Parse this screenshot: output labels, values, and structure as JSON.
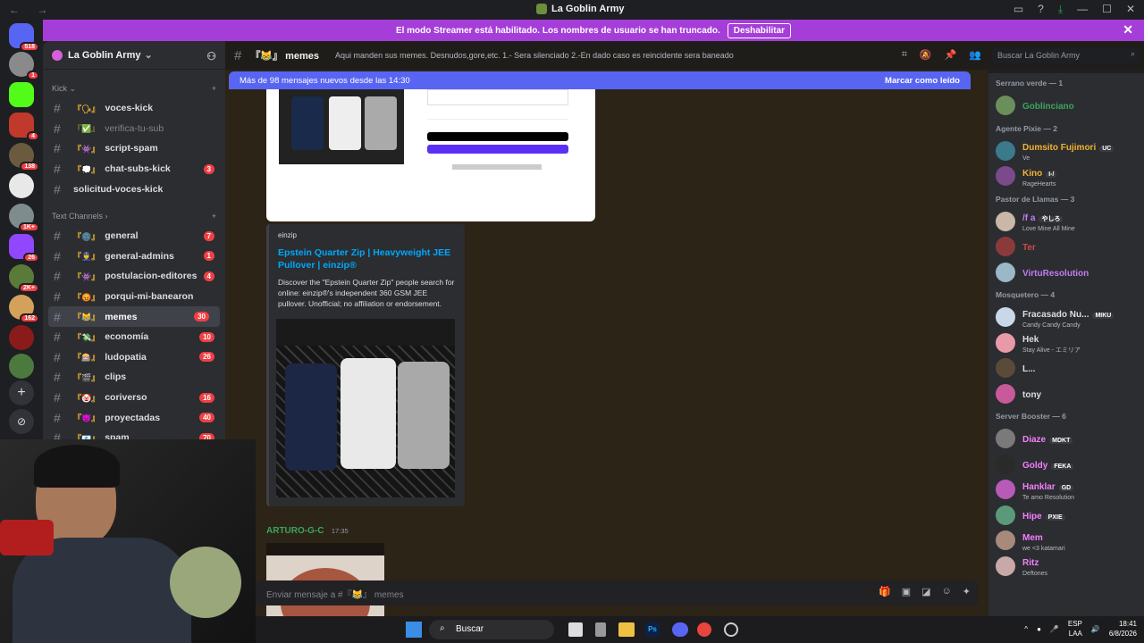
{
  "window": {
    "title": "La Goblin Army"
  },
  "streamer_banner": {
    "text": "El modo Streamer está habilitado. Los nombres de usuario se han truncado.",
    "button": "Deshabilitar"
  },
  "guild_badges": [
    "518",
    "1",
    "4",
    "138",
    "1K+",
    "26",
    "2K+",
    "162"
  ],
  "server": {
    "name": "La Goblin Army"
  },
  "categories": [
    {
      "name": "Kick",
      "channels": [
        {
          "name": "voces-kick",
          "emoji": "『🗣』",
          "muted": false,
          "badge": ""
        },
        {
          "name": "verifica-tu-sub",
          "emoji": "『✅』",
          "muted": true,
          "badge": ""
        },
        {
          "name": "script-spam",
          "emoji": "『👾』",
          "muted": false,
          "badge": ""
        },
        {
          "name": "chat-subs-kick",
          "emoji": "『💭』",
          "muted": false,
          "badge": "3"
        },
        {
          "name": "solicitud-voces-kick",
          "emoji": "",
          "muted": false,
          "badge": ""
        }
      ]
    },
    {
      "name": "Text Channels",
      "channels": [
        {
          "name": "general",
          "emoji": "『🌚』",
          "muted": false,
          "badge": "7"
        },
        {
          "name": "general-admins",
          "emoji": "『👮』",
          "muted": false,
          "badge": "1"
        },
        {
          "name": "postulacion-editores",
          "emoji": "『👾』",
          "muted": false,
          "badge": "4"
        },
        {
          "name": "porqui-mi-banearon",
          "emoji": "『😡』",
          "muted": false,
          "badge": ""
        },
        {
          "name": "memes",
          "emoji": "『😹』",
          "muted": false,
          "badge": "30",
          "active": true
        },
        {
          "name": "economía",
          "emoji": "『💸』",
          "muted": false,
          "badge": "10"
        },
        {
          "name": "ludopatia",
          "emoji": "『🎰』",
          "muted": false,
          "badge": "26"
        },
        {
          "name": "clips",
          "emoji": "『🎬』",
          "muted": false,
          "badge": ""
        },
        {
          "name": "coriverso",
          "emoji": "『🤡』",
          "muted": false,
          "badge": "16"
        },
        {
          "name": "proyectadas",
          "emoji": "『😈』",
          "muted": false,
          "badge": "40"
        },
        {
          "name": "spam",
          "emoji": "『📧』",
          "muted": false,
          "badge": "70"
        }
      ]
    }
  ],
  "channel_header": {
    "name": "memes",
    "emoji": "『😹』",
    "topic": "Aqui manden sus memes. Desnudos,gore,etc. 1.- Sera silenciado 2.-En dado caso es reincidente sera baneado"
  },
  "search": {
    "placeholder": "Buscar La Goblin Army"
  },
  "new_messages": {
    "text": "Más de 98 mensajes nuevos desde las 14:30",
    "mark": "Marcar como leído"
  },
  "embed": {
    "provider": "einzip",
    "title": "Epstein Quarter Zip | Heavyweight JEE Pullover | einzip®",
    "description": "Discover the \"Epstein Quarter Zip\" people search for online: einzip®'s independent 360 GSM JEE pullover. Unofficial; no affiliation or endorsement."
  },
  "message": {
    "author": "ARTURO-G-C",
    "time": "17:35"
  },
  "composer": {
    "placeholder": "Enviar mensaje a #『😹』 memes"
  },
  "member_groups": [
    {
      "name": "Serrano verde — 1",
      "members": [
        {
          "name": "Goblinciano",
          "status": "",
          "color": "#3ba55c",
          "tag": ""
        }
      ]
    },
    {
      "name": "Agente Pixie — 2",
      "members": [
        {
          "name": "Dumsito Fujimori",
          "status": "Ve",
          "color": "#f0b232",
          "tag": "UC"
        },
        {
          "name": "Kino",
          "status": "RageHearts",
          "color": "#f0b232",
          "tag": "I-/"
        }
      ]
    },
    {
      "name": "Pastor de Llamas — 3",
      "members": [
        {
          "name": "/f a",
          "status": "Love Mine All Mine",
          "color": "#c27cf0",
          "tag": "やしろ"
        },
        {
          "name": "Ter",
          "status": "",
          "color": "#c94a4a",
          "tag": ""
        },
        {
          "name": "VirtuResolution",
          "status": "",
          "color": "#c27cf0",
          "tag": ""
        }
      ]
    },
    {
      "name": "Mosquetero — 4",
      "members": [
        {
          "name": "Fracasado Nu...",
          "status": "Candy Candy Candy",
          "color": "#dbdee1",
          "tag": "MIKU"
        },
        {
          "name": "Hek",
          "status": "Stay Alive - エミリア",
          "color": "#dbdee1",
          "tag": ""
        },
        {
          "name": "L...",
          "status": "",
          "color": "#dbdee1",
          "tag": ""
        },
        {
          "name": "tony",
          "status": "",
          "color": "#dbdee1",
          "tag": ""
        }
      ]
    },
    {
      "name": "Server Booster — 6",
      "members": [
        {
          "name": "Diaze",
          "status": "",
          "color": "#f47fff",
          "tag": "MDKT"
        },
        {
          "name": "Goldy",
          "status": "",
          "color": "#f47fff",
          "tag": "FEKA"
        },
        {
          "name": "Hanklar",
          "status": "Te amo Resolution",
          "color": "#f47fff",
          "tag": "GD"
        },
        {
          "name": "Hipe",
          "status": "",
          "color": "#f47fff",
          "tag": "PXIE"
        },
        {
          "name": "Mem",
          "status": "we <3 katamari",
          "color": "#f47fff",
          "tag": ""
        },
        {
          "name": "Ritz",
          "status": "Deftones",
          "color": "#f47fff",
          "tag": ""
        }
      ]
    }
  ],
  "taskbar": {
    "search": "Buscar",
    "lang": "ESP",
    "lang2": "LAA",
    "time": "18:41",
    "date": "6/8/2026"
  }
}
